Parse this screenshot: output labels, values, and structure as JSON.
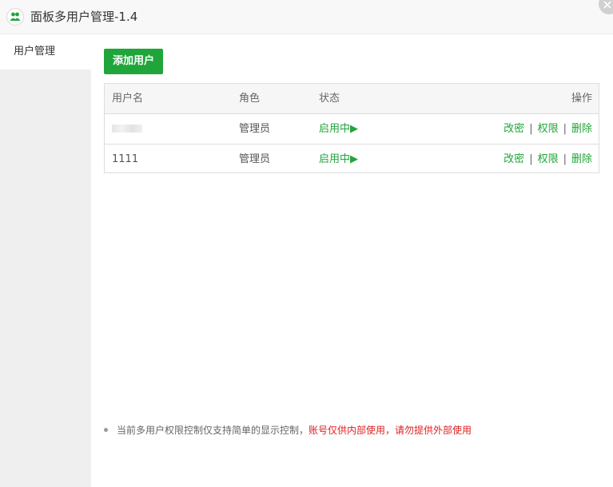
{
  "window": {
    "title": "面板多用户管理-1.4"
  },
  "sidebar": {
    "items": [
      {
        "label": "用户管理"
      }
    ]
  },
  "toolbar": {
    "add_label": "添加用户"
  },
  "table": {
    "headers": {
      "user": "用户名",
      "role": "角色",
      "status": "状态",
      "ops": "操作"
    },
    "rows": [
      {
        "user": "",
        "role": "管理员",
        "status": "启用中▶",
        "ops": {
          "change_pwd": "改密",
          "perms": "权限",
          "delete": "删除",
          "sep": "|"
        }
      },
      {
        "user": "1111",
        "role": "管理员",
        "status": "启用中▶",
        "ops": {
          "change_pwd": "改密",
          "perms": "权限",
          "delete": "删除",
          "sep": "|"
        }
      }
    ]
  },
  "note": {
    "text": "当前多用户权限控制仅支持简单的显示控制，",
    "warning": "账号仅供内部使用，请勿提供外部使用"
  },
  "colors": {
    "accent": "#20a53a",
    "warning": "#e02020"
  },
  "icons": {
    "logo": "users-icon",
    "close": "close-icon"
  }
}
